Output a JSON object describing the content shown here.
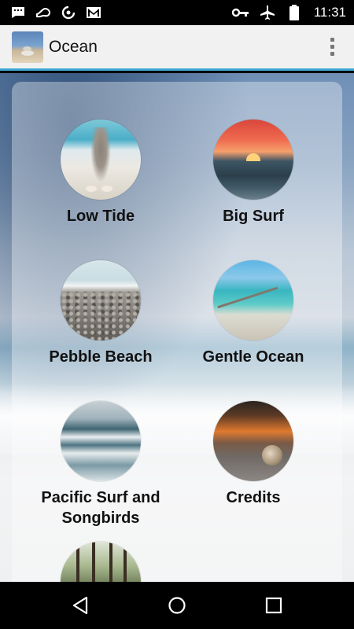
{
  "status_bar": {
    "time": "11:31",
    "left_icons": [
      "chat-icon",
      "steam-icon",
      "refresh-icon",
      "gmail-icon"
    ],
    "right_icons": [
      "key-icon",
      "airplane-icon",
      "battery-icon"
    ]
  },
  "app_bar": {
    "title": "Ocean",
    "accent_color": "#3fa7d6"
  },
  "tiles": [
    {
      "label": "Low Tide",
      "thumb": "low-tide"
    },
    {
      "label": "Big Surf",
      "thumb": "big-surf"
    },
    {
      "label": "Pebble Beach",
      "thumb": "pebble-beach"
    },
    {
      "label": "Gentle Ocean",
      "thumb": "gentle-ocean"
    },
    {
      "label": "Pacific Surf and Songbirds",
      "thumb": "pacific-surf"
    },
    {
      "label": "Credits",
      "thumb": "credits"
    },
    {
      "label": "",
      "thumb": "forest"
    }
  ],
  "nav_bar": {
    "buttons": [
      "back-icon",
      "home-icon",
      "recents-icon"
    ]
  }
}
